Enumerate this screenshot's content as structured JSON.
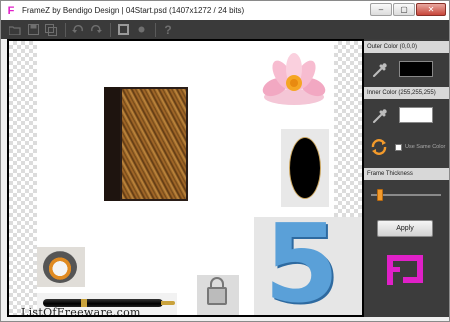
{
  "window": {
    "title": "FrameZ by Bendigo Design | 04Start.psd (1407x1272 / 24 bits)",
    "controls": {
      "minimize": "–",
      "maximize": "▢",
      "close": "✕"
    }
  },
  "toolbar": {
    "icons": [
      "open-icon",
      "save-icon",
      "save-all-icon",
      "undo-icon",
      "redo-icon",
      "frame-icon",
      "settings-icon",
      "help-icon"
    ],
    "help_label": "?"
  },
  "canvas": {
    "watermark": "ListOfFreeware.com"
  },
  "panel": {
    "outer_color": {
      "label": "Outer Color (0,0,0)",
      "swatch": "#000000"
    },
    "inner_color": {
      "label": "Inner Color (255,255,255)",
      "swatch": "#ffffff"
    },
    "use_same_color_label": "Use Same Color",
    "use_same_color_checked": false,
    "frame_thickness": {
      "label": "Frame Thickness",
      "value_fraction": 0.08
    },
    "apply_label": "Apply",
    "logo_text": "FZ",
    "accent": "#f39a2b",
    "logo_color": "#e020c8"
  }
}
